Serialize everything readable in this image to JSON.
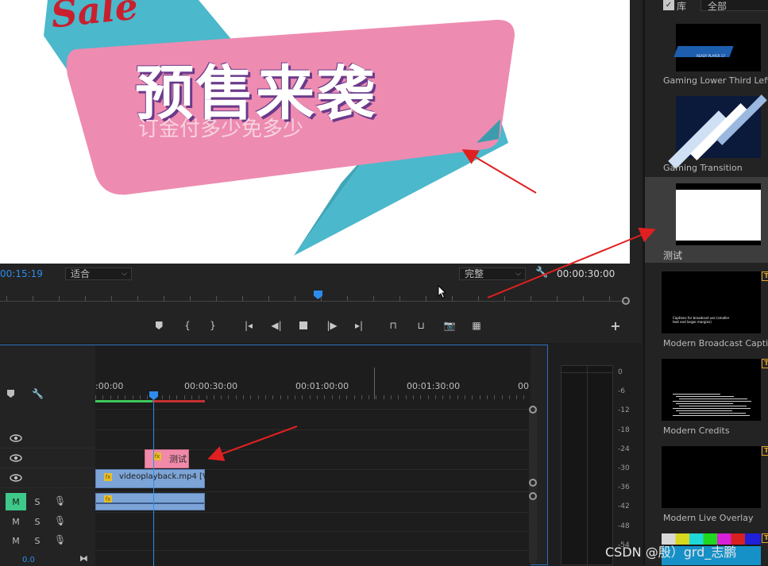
{
  "graphic": {
    "sale_text": "Sale",
    "headline": "预售来袭",
    "subline": "订金付多少免多少"
  },
  "program_monitor": {
    "current_timecode": "00:15:19",
    "fit_label": "适合",
    "quality_label": "完整",
    "duration": "00:00:30:00",
    "buttons": [
      "marker",
      "in-point",
      "out-point",
      "go-to-in",
      "step-back",
      "stop",
      "step-forward",
      "go-to-out",
      "lift",
      "extract",
      "export-frame",
      "comparison"
    ]
  },
  "timeline": {
    "ruler_labels": [
      ":00:00",
      "00:00:30:00",
      "00:01:00:00",
      "00:01:30:00",
      "00"
    ],
    "tracks": {
      "video": [
        {
          "clip": ""
        },
        {
          "clip": "测试"
        },
        {
          "clip": "videoplayback.mp4 [V]"
        }
      ],
      "audio": [
        {
          "m": "M",
          "s": "S"
        },
        {
          "m": "M",
          "s": "S"
        },
        {
          "m": "M",
          "s": "S"
        }
      ]
    },
    "zoom_value": "0.0"
  },
  "audio_meter": {
    "scale": [
      "0",
      "-6",
      "-12",
      "-18",
      "-24",
      "-30",
      "-36",
      "-42",
      "-48",
      "-54"
    ]
  },
  "essential_graphics": {
    "library_checkbox_label": "库",
    "filter_value": "全部",
    "templates": [
      {
        "name": "Gaming Lower Third Left",
        "thumb_text": "READY PLAYER 17"
      },
      {
        "name": "Gaming Transition"
      },
      {
        "name": "测试",
        "selected": true
      },
      {
        "name": "Modern Broadcast Caption",
        "thumb_text": "Captions for broadcast use (smaller text and larger margins)",
        "badge": "T"
      },
      {
        "name": "Modern Credits",
        "badge": "T"
      },
      {
        "name": "Modern Live Overlay",
        "badge": "T"
      },
      {
        "name": "",
        "badge": "T"
      }
    ]
  },
  "watermark": "CSDN @殷）grd_志鹏",
  "colors": {
    "accent_blue": "#2d8ceb",
    "pink_banner": "#ee8bb0",
    "teal_banner": "#4bb8cb",
    "clip_pink": "#f08aa8",
    "clip_blue": "#7da4d6",
    "mute_green": "#3ec98a",
    "badge_orange": "#e6a72a",
    "arrow_red": "#e02020"
  }
}
